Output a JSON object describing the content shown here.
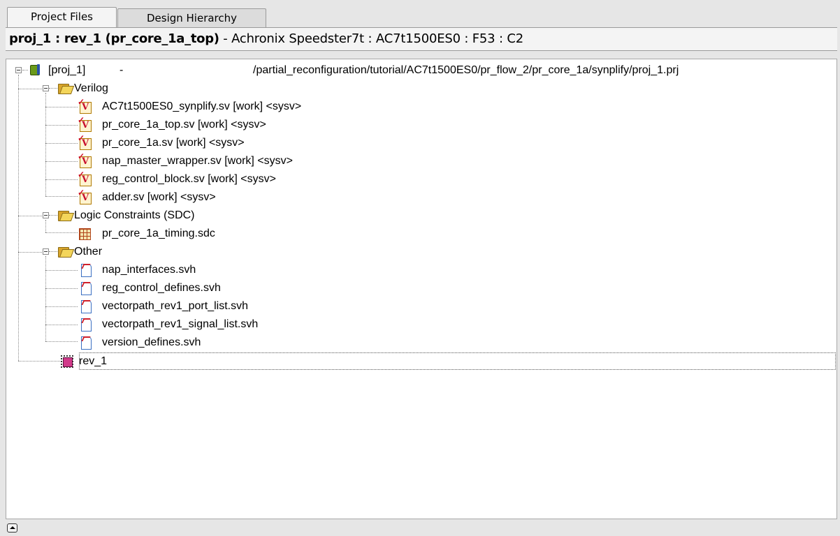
{
  "tabs": [
    {
      "label": "Project Files",
      "active": true
    },
    {
      "label": "Design Hierarchy",
      "active": false
    }
  ],
  "header": {
    "bold": "proj_1 : rev_1 (pr_core_1a_top)",
    "rest": " - Achronix Speedster7t : AC7t1500ES0 : F53 : C2"
  },
  "tree": {
    "project": {
      "name": "[proj_1]",
      "dash": "-",
      "path": "/partial_reconfiguration/tutorial/AC7t1500ES0/pr_flow_2/pr_core_1a/synplify/proj_1.prj"
    },
    "verilog": {
      "label": "Verilog",
      "files": [
        "AC7t1500ES0_synplify.sv [work]  <sysv>",
        "pr_core_1a_top.sv [work]  <sysv>",
        "pr_core_1a.sv [work]  <sysv>",
        "nap_master_wrapper.sv [work]  <sysv>",
        "reg_control_block.sv [work]  <sysv>",
        "adder.sv [work]  <sysv>"
      ]
    },
    "constraints": {
      "label": "Logic Constraints (SDC)",
      "files": [
        "pr_core_1a_timing.sdc"
      ]
    },
    "other": {
      "label": "Other",
      "files": [
        "nap_interfaces.svh",
        "reg_control_defines.svh",
        "vectorpath_rev1_port_list.svh",
        "vectorpath_rev1_signal_list.svh",
        "version_defines.svh"
      ]
    },
    "implementation": {
      "label": "rev_1"
    }
  },
  "icons": {
    "project": "project-icon",
    "folder": "folder-open-icon",
    "verilog_file": "verilog-file-icon",
    "sdc_file": "sdc-file-icon",
    "header_file": "svh-file-icon",
    "implementation": "chip-icon",
    "collapse": "collapse-expander-icon"
  }
}
